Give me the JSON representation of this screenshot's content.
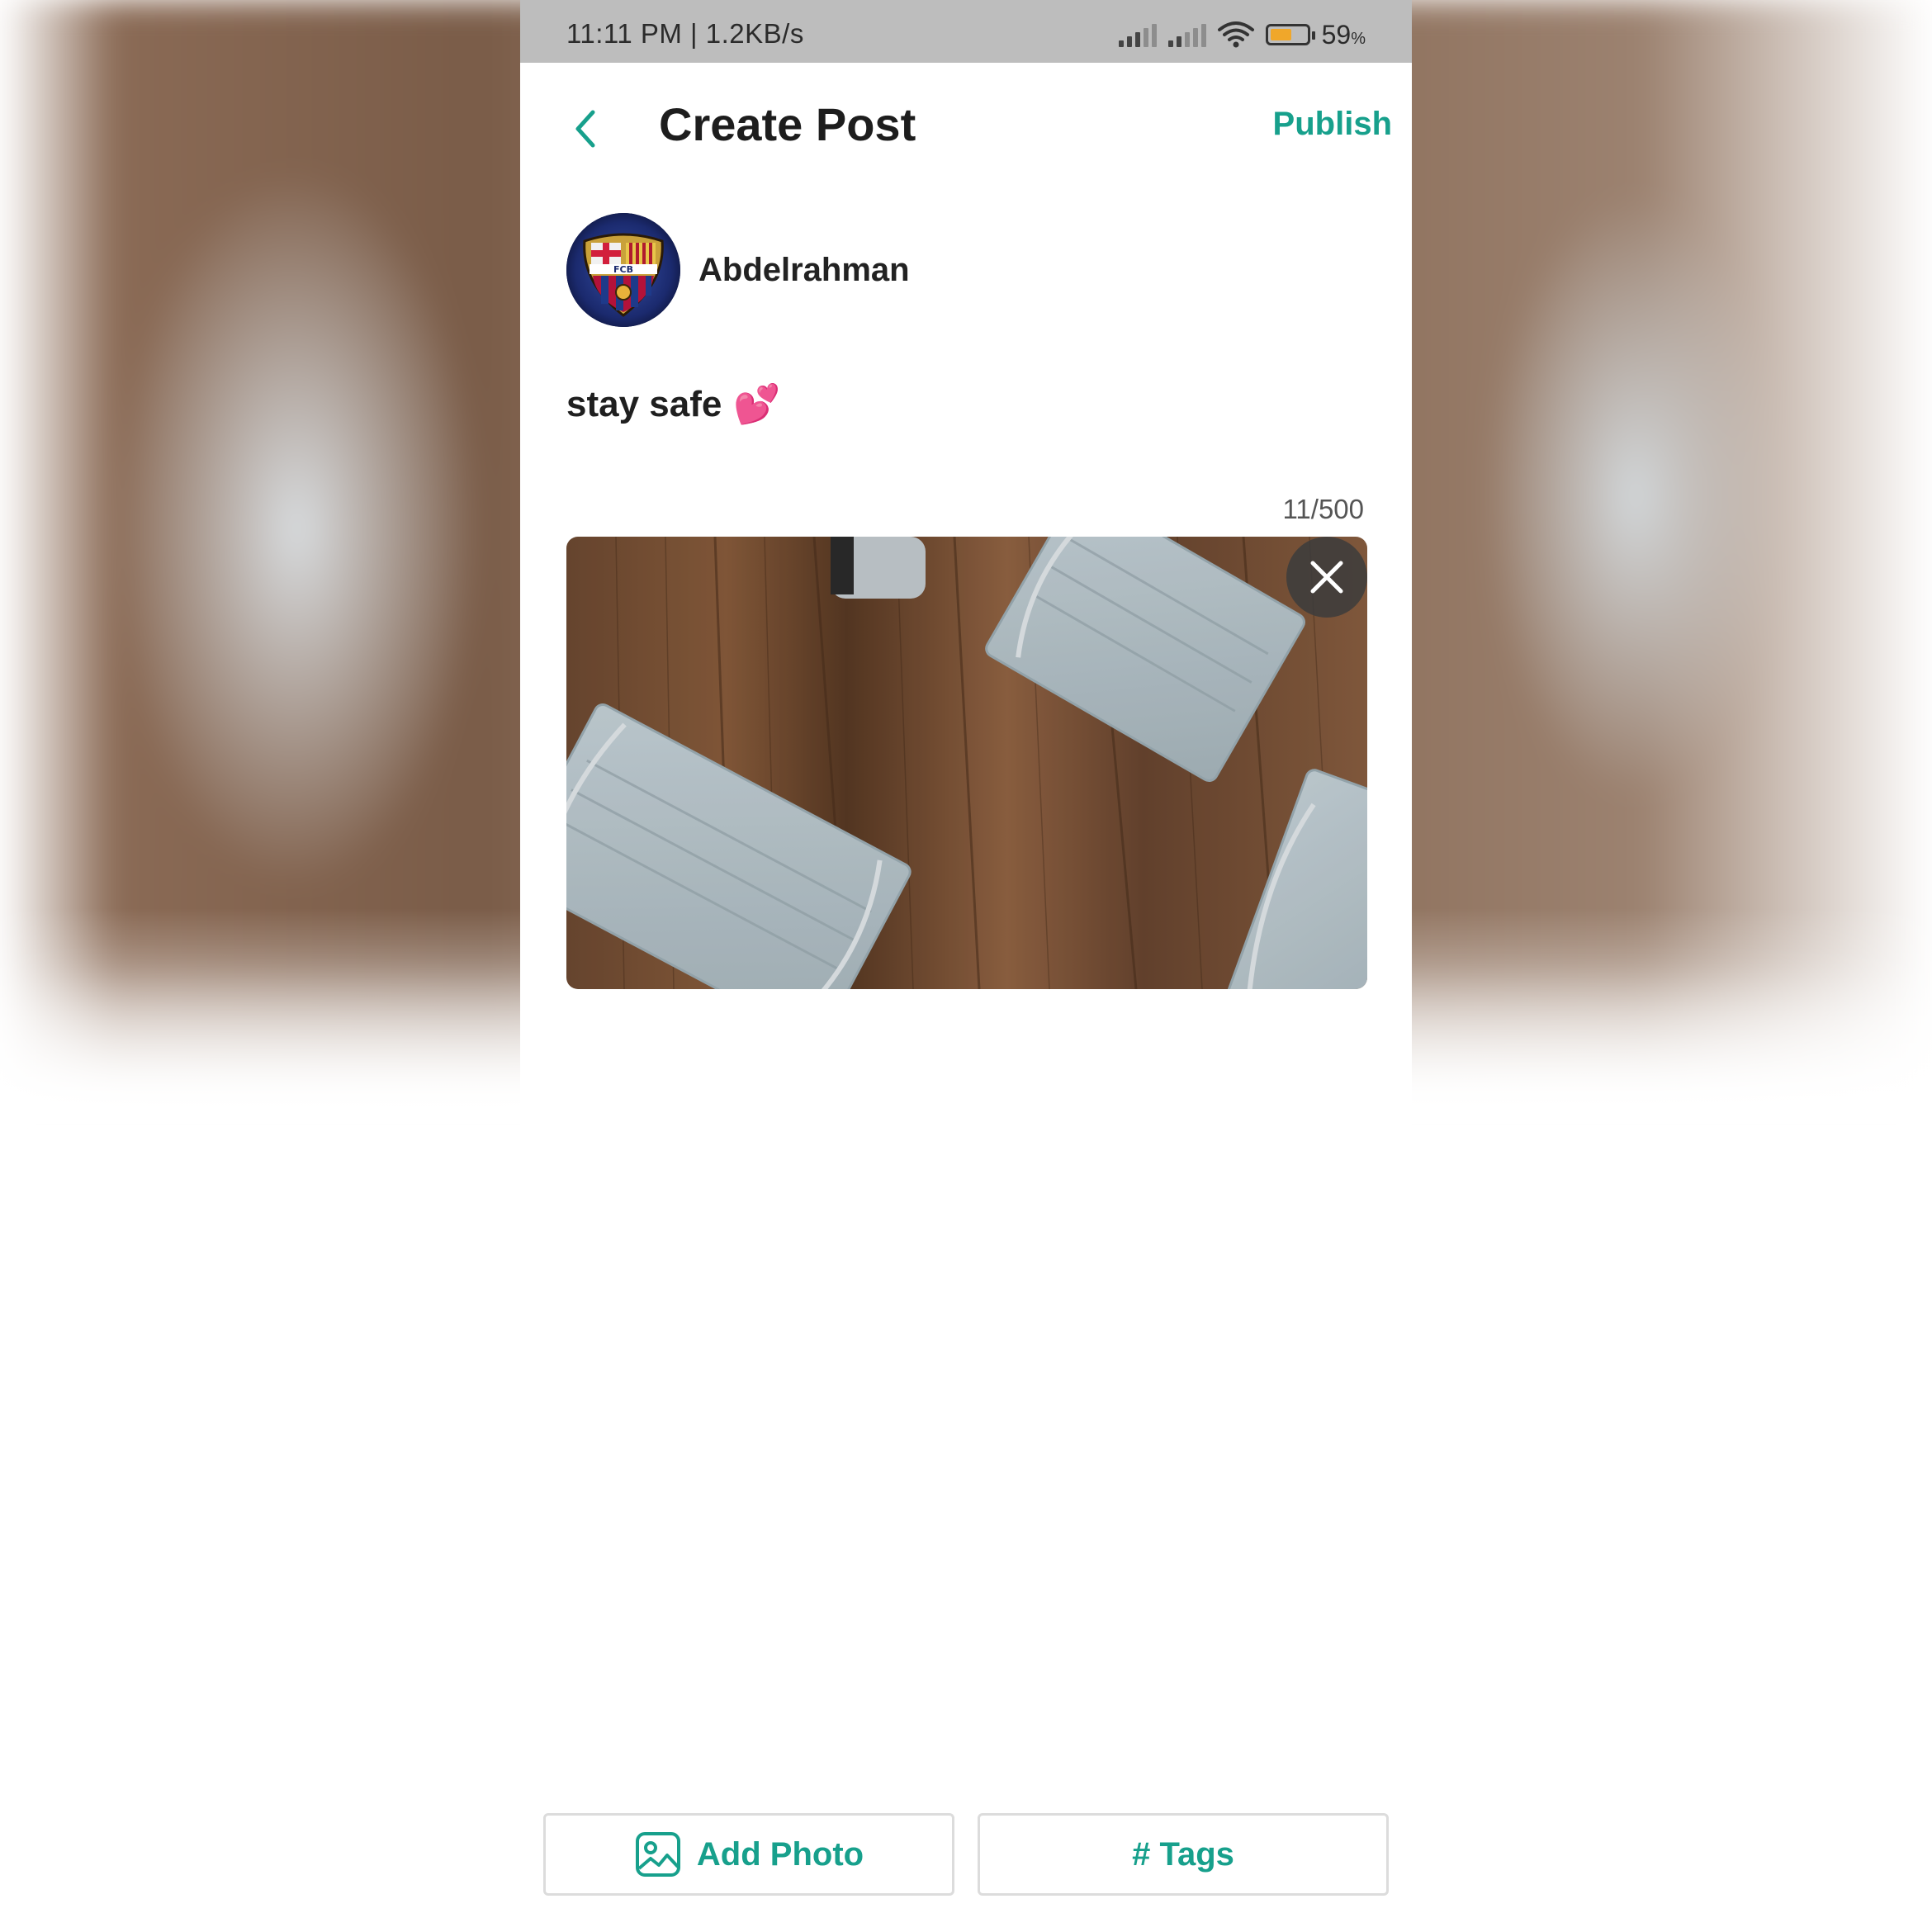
{
  "status_bar": {
    "time_speed": "11:11 PM | 1.2KB/s",
    "battery_percent": "59",
    "battery_unit": "%",
    "battery_level": 0.59,
    "battery_color": "#f0a72a"
  },
  "header": {
    "title": "Create Post",
    "publish_label": "Publish",
    "accent_color": "#17a08c",
    "back_icon": "chevron-left-icon"
  },
  "author": {
    "name": "Abdelrahman",
    "avatar_icon": "fcb-crest-avatar"
  },
  "composer": {
    "text": "stay safe",
    "emoji": "💕",
    "char_count": "11/500"
  },
  "photo": {
    "remove_icon": "close-icon",
    "logo_text": "FCB"
  },
  "bottom_bar": {
    "add_photo_label": "Add Photo",
    "tags_label": "# Tags"
  }
}
